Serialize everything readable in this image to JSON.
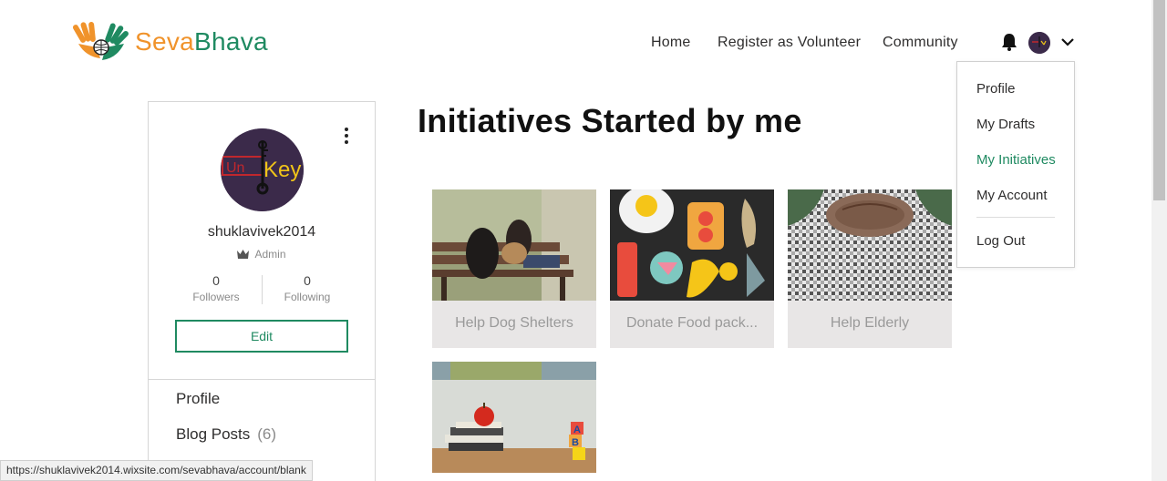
{
  "brand": {
    "seva": "Seva",
    "bhava": "Bhava",
    "logo_icon": "hands-globe-logo-icon"
  },
  "nav": {
    "home": "Home",
    "register": "Register as Volunteer",
    "community": "Community"
  },
  "header_icons": {
    "bell": "bell-icon",
    "avatar": "user-avatar",
    "chevron": "chevron-down-icon"
  },
  "dropdown": {
    "items": [
      "Profile",
      "My Drafts",
      "My Initiatives",
      "My Account"
    ],
    "active": "My Initiatives",
    "logout": "Log Out"
  },
  "profile": {
    "username": "shuklavivek2014",
    "role": "Admin",
    "avatar_text": "Key",
    "followers_count": "0",
    "followers_label": "Followers",
    "following_count": "0",
    "following_label": "Following",
    "edit_label": "Edit"
  },
  "side_menu": {
    "profile": "Profile",
    "blog_posts": "Blog Posts",
    "blog_posts_count": "(6)"
  },
  "main": {
    "title": "Initiatives Started by me",
    "tiles": [
      {
        "caption": "Help Dog Shelters",
        "image": "woman-with-dogs-on-bench"
      },
      {
        "caption": "Donate Food pack...",
        "image": "food-illustration"
      },
      {
        "caption": "Help Elderly",
        "image": "elderly-hands"
      },
      {
        "caption": "",
        "image": "books-and-apple"
      }
    ]
  },
  "status_bar": {
    "url": "https://shuklavivek2014.wixsite.com/sevabhava/account/blank"
  },
  "colors": {
    "brand_green": "#1f8a61",
    "brand_orange": "#f0932b",
    "caption_bg": "#e8e6e6"
  }
}
